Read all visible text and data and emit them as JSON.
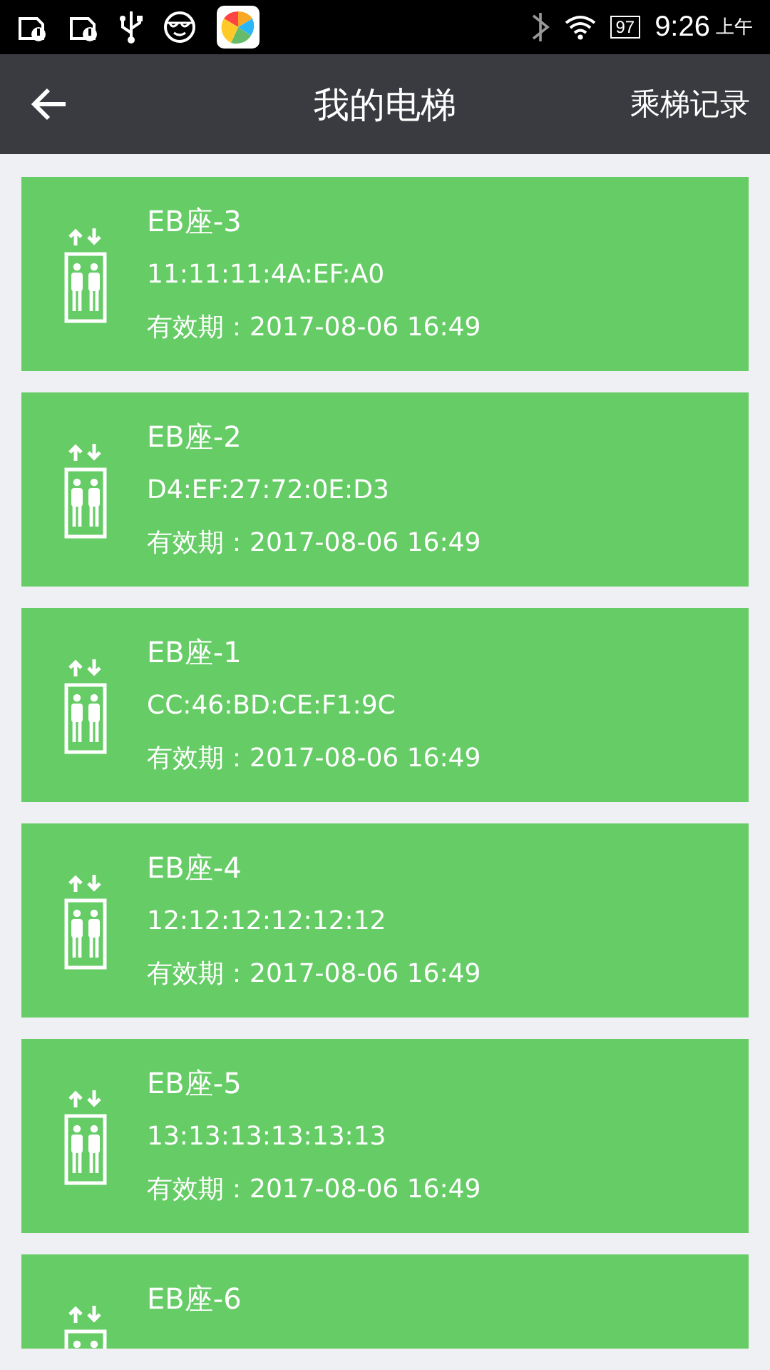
{
  "status_bar": {
    "battery": "97",
    "time": "9:26",
    "am_pm": "上午"
  },
  "header": {
    "title": "我的电梯",
    "action": "乘梯记录"
  },
  "elevators": [
    {
      "name": "EB座-3",
      "mac": "11:11:11:4A:EF:A0",
      "validity": "有效期：2017-08-06 16:49"
    },
    {
      "name": "EB座-2",
      "mac": "D4:EF:27:72:0E:D3",
      "validity": "有效期：2017-08-06 16:49"
    },
    {
      "name": "EB座-1",
      "mac": "CC:46:BD:CE:F1:9C",
      "validity": "有效期：2017-08-06 16:49"
    },
    {
      "name": "EB座-4",
      "mac": "12:12:12:12:12:12",
      "validity": "有效期：2017-08-06 16:49"
    },
    {
      "name": "EB座-5",
      "mac": "13:13:13:13:13:13",
      "validity": "有效期：2017-08-06 16:49"
    },
    {
      "name": "EB座-6"
    }
  ]
}
